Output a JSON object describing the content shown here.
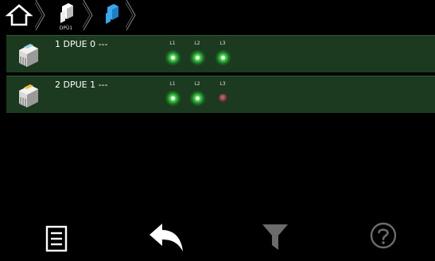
{
  "breadcrumb": {
    "items": [
      {
        "name": "home",
        "icon": "home-icon"
      },
      {
        "name": "dpu-group",
        "icon": "dpu-device-icon",
        "label": "DPÜ1"
      },
      {
        "name": "dpu-current",
        "icon": "dpu-device-icon"
      }
    ]
  },
  "devices": [
    {
      "title": "1 DPUE 0 ---",
      "icon": "dpu-device-icon",
      "phases": [
        {
          "label": "L1",
          "state": "ok",
          "color": "#2fbf3a"
        },
        {
          "label": "L2",
          "state": "ok",
          "color": "#2fbf3a"
        },
        {
          "label": "L3",
          "state": "ok",
          "color": "#2fbf3a"
        }
      ]
    },
    {
      "title": "2 DPUE 1 ---",
      "icon": "dpu-device-warning-icon",
      "phases": [
        {
          "label": "L1",
          "state": "ok",
          "color": "#2fbf3a"
        },
        {
          "label": "L2",
          "state": "ok",
          "color": "#2fbf3a"
        },
        {
          "label": "L3",
          "state": "off",
          "color": "#7a3a42"
        }
      ]
    }
  ],
  "toolbar": {
    "items": [
      {
        "name": "list-icon"
      },
      {
        "name": "back-icon"
      },
      {
        "name": "filter-icon",
        "state": "disabled"
      },
      {
        "name": "help-icon",
        "state": "disabled"
      }
    ]
  },
  "colors": {
    "row_background": "#1c3a1f",
    "led_on": "#2fbf3a",
    "led_off": "#7a3a42",
    "accent_blue": "#1e8fd8"
  }
}
